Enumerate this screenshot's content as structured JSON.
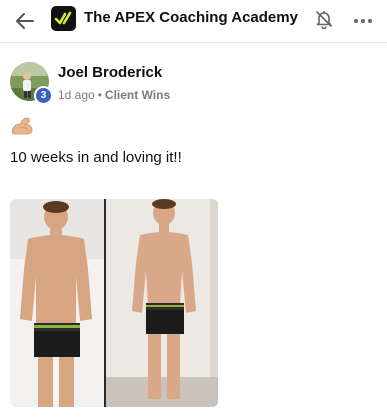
{
  "header": {
    "back_icon": "arrow-left-icon",
    "logo_icon": "apex-logo-icon",
    "title": "The APEX Coaching Academy",
    "bell_icon": "bell-muted-icon",
    "more_icon": "more-horizontal-icon"
  },
  "post": {
    "author": "Joel Broderick",
    "level": "3",
    "time": "1d ago",
    "separator": "•",
    "category": "Client Wins",
    "emoji_icon": "flexed-biceps-icon",
    "text": "10 weeks in and loving it!!",
    "image": "before-after-photo"
  },
  "colors": {
    "accent": "#3a5fc6",
    "logo_bg": "#111111",
    "logo_mark": "#c8f03a",
    "meta": "#7a7a7a"
  }
}
